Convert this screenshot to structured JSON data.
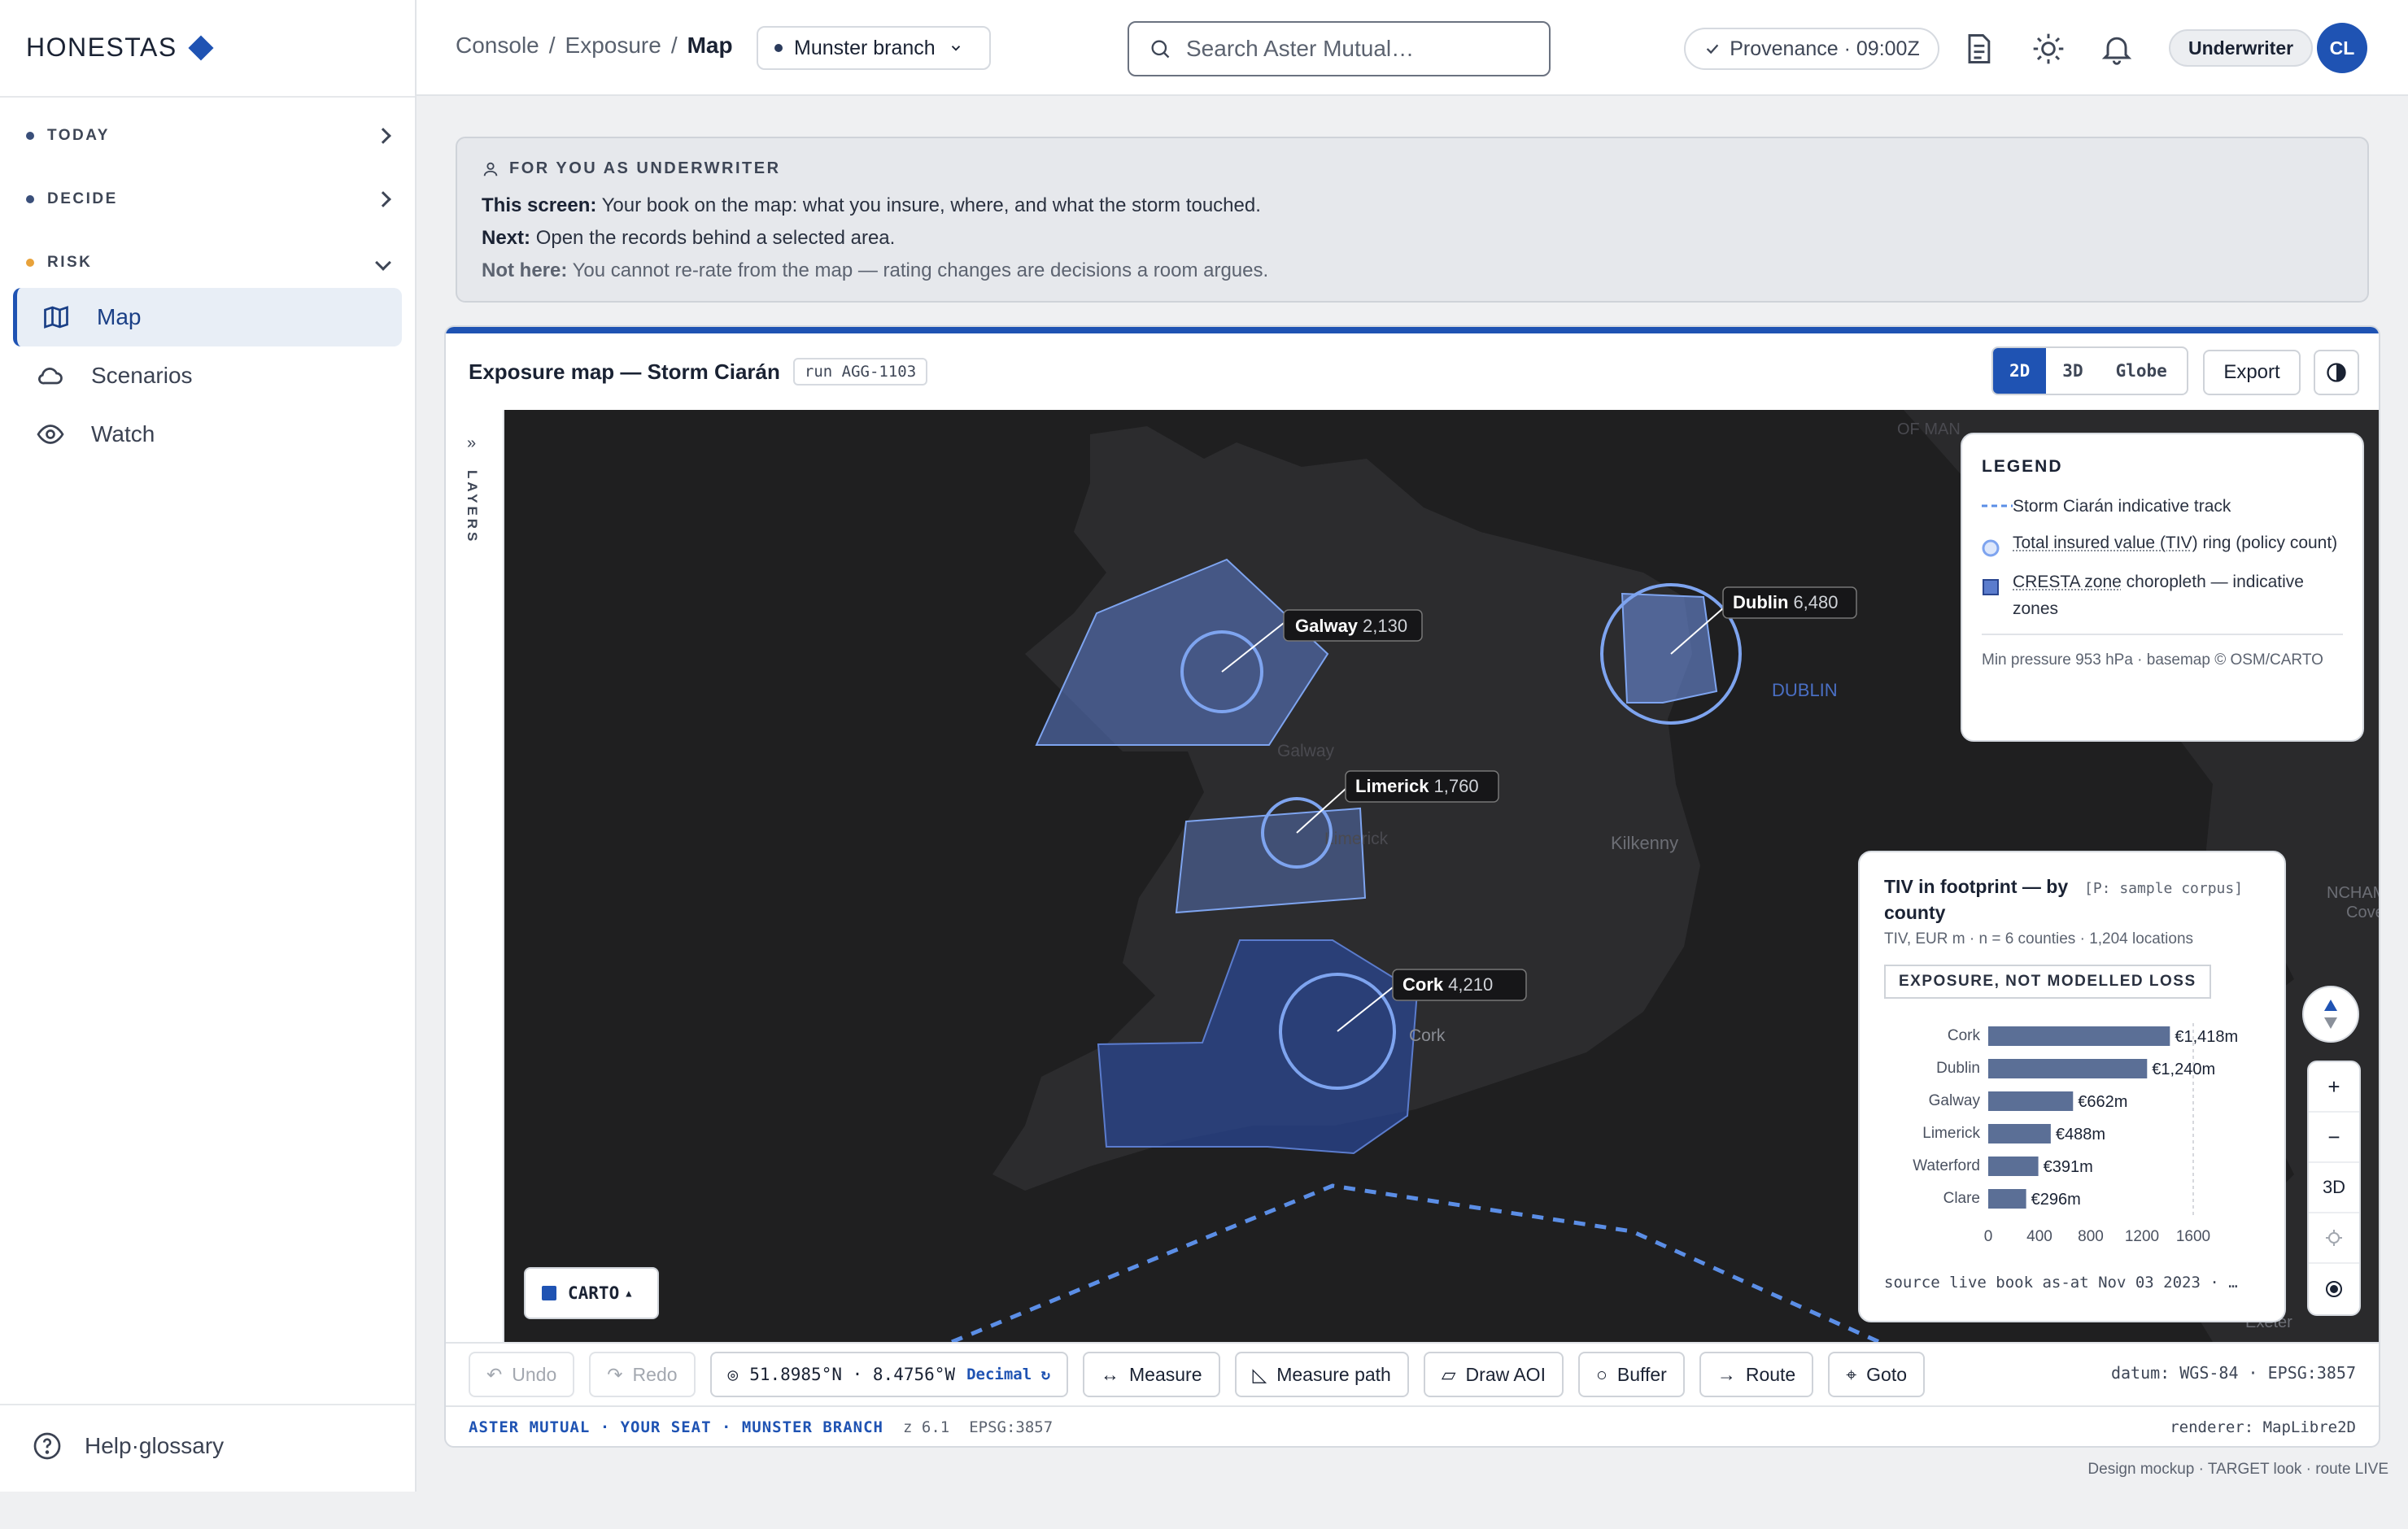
{
  "brand": {
    "name": "HONESTAS"
  },
  "sidebar": {
    "sections": [
      {
        "label": "TODAY",
        "dot_color": "#3a4f7a"
      },
      {
        "label": "DECIDE",
        "dot_color": "#3a4f7a"
      },
      {
        "label": "RISK",
        "dot_color": "#e8a23a"
      }
    ],
    "items": [
      {
        "label": "Map",
        "icon": "map-icon",
        "active": true
      },
      {
        "label": "Scenarios",
        "icon": "cloud-icon"
      },
      {
        "label": "Watch",
        "icon": "eye-icon"
      }
    ],
    "help_label": "Help·glossary"
  },
  "header": {
    "breadcrumb": [
      "Console",
      "Exposure",
      "Map"
    ],
    "branch": "Munster branch",
    "search_placeholder": "Search Aster Mutual…",
    "provenance": "Provenance · 09:00Z",
    "role": "Underwriter",
    "avatar_initials": "CL"
  },
  "notice": {
    "heading": "FOR YOU AS UNDERWRITER",
    "lines": [
      {
        "label": "This screen:",
        "text": "Your book on the map: what you insure, where, and what the storm touched."
      },
      {
        "label": "Next:",
        "text": "Open the records behind a selected area."
      },
      {
        "label": "Not here:",
        "text": "You cannot re-rate from the map — rating changes are decisions a room argues."
      }
    ]
  },
  "panel": {
    "title": "Exposure map — Storm Ciarán",
    "run_tag": "run AGG-1103",
    "view_modes": [
      "2D",
      "3D",
      "Globe"
    ],
    "active_mode": "2D",
    "export_label": "Export",
    "layers_label": "LAYERS"
  },
  "map": {
    "labels": [
      {
        "name": "Galway",
        "value": "2,130"
      },
      {
        "name": "Dublin",
        "value": "6,480"
      },
      {
        "name": "Limerick",
        "value": "1,760"
      },
      {
        "name": "Cork",
        "value": "4,210"
      }
    ],
    "basemap_text": [
      "Galway",
      "DUBLIN",
      "Limerick",
      "Kilkenny",
      "Cork",
      "Exeter",
      "NCHAM",
      "OF MAN",
      "Cove"
    ],
    "basemap_button": "CARTO",
    "controls": [
      "+",
      "−",
      "3D"
    ]
  },
  "legend": {
    "title": "LEGEND",
    "items": [
      {
        "label": "Storm Ciarán indicative track"
      },
      {
        "label_link": "Total insured value (TIV)",
        "label_rest": " ring (policy count)"
      },
      {
        "label_link": "CRESTA zone",
        "label_rest": " choropleth — indicative zones"
      }
    ],
    "footer": "Min pressure 953 hPa · basemap © OSM/CARTO"
  },
  "chart_data": {
    "type": "bar",
    "title": "TIV in footprint — by county",
    "tag": "[P: sample corpus]",
    "subtitle": "TIV, EUR m · n = 6 counties · 1,204 locations",
    "badge": "EXPOSURE, NOT MODELLED LOSS",
    "categories": [
      "Cork",
      "Dublin",
      "Galway",
      "Limerick",
      "Waterford",
      "Clare"
    ],
    "values": [
      1418,
      1240,
      662,
      488,
      391,
      296
    ],
    "value_labels": [
      "€1,418m",
      "€1,240m",
      "€662m",
      "€488m",
      "€391m",
      "€296m"
    ],
    "xticks": [
      "0",
      "400",
      "800",
      "1200",
      "1600"
    ],
    "xlim": [
      0,
      1600
    ],
    "bar_color": "#5b6f96",
    "source": "source live book as-at Nov 03 2023 · …"
  },
  "toolbar": {
    "undo": "Undo",
    "redo": "Redo",
    "coordinate": "51.8985°N · 8.4756°W",
    "coord_format": "Decimal ↻",
    "tools": [
      "Measure",
      "Measure path",
      "Draw AOI",
      "Buffer",
      "Route",
      "Goto"
    ],
    "datum": "datum: WGS-84 · EPSG:3857"
  },
  "status": {
    "seat": "ASTER MUTUAL · YOUR SEAT · MUNSTER BRANCH",
    "zoom": "z 6.1",
    "epsg": "EPSG:3857",
    "renderer": "renderer: MapLibre2D"
  },
  "footer_note": "Design mockup · TARGET look · route LIVE",
  "colors": {
    "accent": "#1f53b3",
    "map_bg": "#1f1f20",
    "ring": "#7ea4ef",
    "track": "#5b8ee6"
  }
}
